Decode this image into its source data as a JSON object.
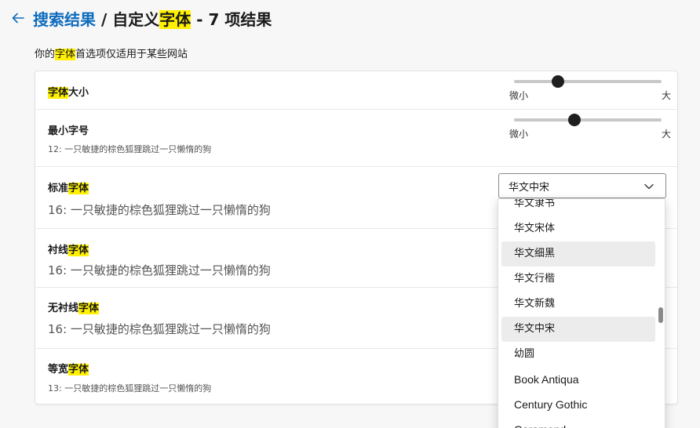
{
  "header": {
    "title_link": "搜索结果",
    "title_sep": " / 自定义",
    "title_hl": "字体",
    "title_tail": " - 7 项结果"
  },
  "subtitle": {
    "pre": "你的",
    "hl": "字体",
    "post": "首选项仅适用于某些网站"
  },
  "rows": {
    "font_size": {
      "label_hl": "字体",
      "label_post": "大小",
      "slider_min": "微小",
      "slider_max": "大",
      "level": 0.3
    },
    "min_size": {
      "label": "最小字号",
      "desc": "12: 一只敏捷的棕色狐狸跳过一只懒惰的狗",
      "slider_min": "微小",
      "slider_max": "大",
      "level": 0.41
    },
    "standard": {
      "label_pre": "标准",
      "label_hl": "字体",
      "desc": "16: 一只敏捷的棕色狐狸跳过一只懒惰的狗",
      "selected": "华文中宋"
    },
    "serif": {
      "label_pre": "衬线",
      "label_hl": "字体",
      "desc": "16: 一只敏捷的棕色狐狸跳过一只懒惰的狗"
    },
    "sans": {
      "label_pre": "无衬线",
      "label_hl": "字体",
      "desc": "16: 一只敏捷的棕色狐狸跳过一只懒惰的狗"
    },
    "mono": {
      "label_pre": "等宽",
      "label_hl": "字体",
      "desc": "13: 一只敏捷的棕色狐狸跳过一只懒惰的狗"
    }
  },
  "dropdown": {
    "items": [
      "华文隶书",
      "华文宋体",
      "华文细黑",
      "华文行楷",
      "华文新魏",
      "华文中宋",
      "幼圆",
      "Book Antiqua",
      "Century Gothic",
      "Garamond"
    ]
  },
  "colors": {
    "accent": "#0f6cbd",
    "highlight": "#fff100"
  }
}
